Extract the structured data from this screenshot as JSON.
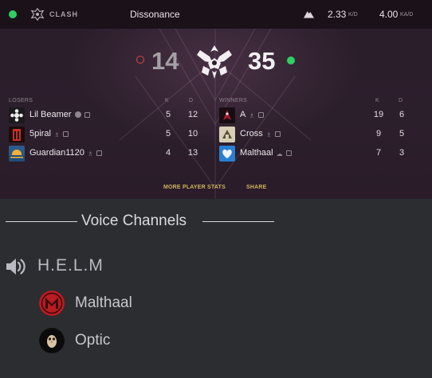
{
  "match": {
    "mode": "CLASH",
    "map": "Dissonance",
    "kd": "2.33",
    "kd_unit": "K/D",
    "kda": "4.00",
    "kda_unit": "KA/D",
    "status_color": "#2fcf63"
  },
  "score": {
    "losers": "14",
    "winners": "35"
  },
  "teams": {
    "losers_label": "LOSERS",
    "winners_label": "WINNERS",
    "k_label": "K",
    "d_label": "D",
    "losers": [
      {
        "name": "Lil Beamer",
        "k": "5",
        "d": "12",
        "icon": "white-flower-emblem"
      },
      {
        "name": "5piral",
        "k": "5",
        "d": "10",
        "icon": "red-tower-emblem"
      },
      {
        "name": "Guardian1120",
        "k": "4",
        "d": "13",
        "icon": "sunset-emblem"
      }
    ],
    "winners": [
      {
        "name": "A",
        "k": "19",
        "d": "6",
        "icon": "dark-red-emblem"
      },
      {
        "name": "Cross",
        "k": "9",
        "d": "5",
        "icon": "beige-emblem"
      },
      {
        "name": "Malthaal",
        "k": "7",
        "d": "3",
        "icon": "blue-heart-emblem"
      }
    ]
  },
  "actions": {
    "more_stats": "MORE PLAYER STATS",
    "share": "SHARE"
  },
  "voice": {
    "title": "Voice Channels",
    "channel": "H.E.L.M",
    "members": [
      {
        "name": "Malthaal",
        "avatar": "red-m-logo"
      },
      {
        "name": "Optic",
        "avatar": "owl-avatar"
      }
    ]
  }
}
